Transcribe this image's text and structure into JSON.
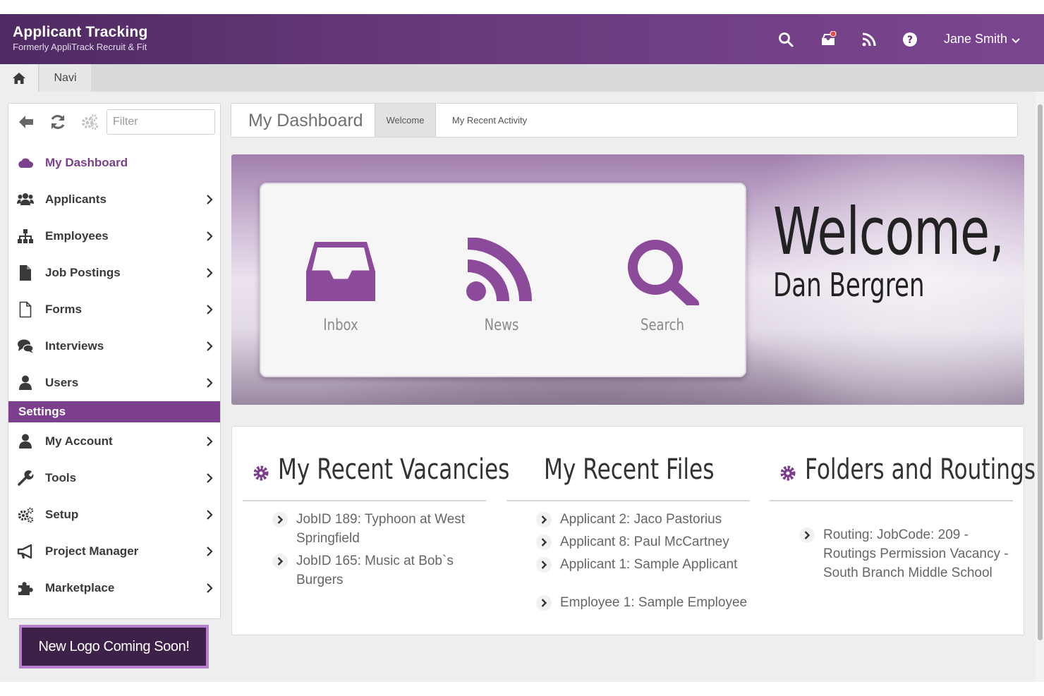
{
  "colors": {
    "brand_purple": "#6a3a7c",
    "accent": "#7b3f8e",
    "logo_button_bg": "#3e2149"
  },
  "header": {
    "app_title": "Applicant Tracking",
    "app_subtitle": "Formerly AppliTrack Recruit & Fit",
    "icons": [
      "search-icon",
      "notifications-icon",
      "rss-feed-icon",
      "help-icon"
    ],
    "user_name": "Jane Smith"
  },
  "breadcrumb": {
    "home_icon": "home-icon",
    "tab_label": "Navi"
  },
  "sidebar": {
    "filter_placeholder": "Filter",
    "tool_icons": [
      "back-icon",
      "refresh-icon",
      "settings-cogs-icon"
    ],
    "items": [
      {
        "label": "My Dashboard",
        "icon": "cloud-icon",
        "active": true
      },
      {
        "label": "Applicants",
        "icon": "users-icon"
      },
      {
        "label": "Employees",
        "icon": "org-chart-icon"
      },
      {
        "label": "Job Postings",
        "icon": "document-icon"
      },
      {
        "label": "Forms",
        "icon": "blank-file-icon"
      },
      {
        "label": "Interviews",
        "icon": "chat-icon"
      },
      {
        "label": "Users",
        "icon": "user-icon"
      }
    ],
    "settings_label": "Settings",
    "settings_items": [
      {
        "label": "My Account",
        "icon": "user-icon"
      },
      {
        "label": "Tools",
        "icon": "wrench-icon"
      },
      {
        "label": "Setup",
        "icon": "cogs-icon"
      },
      {
        "label": "Project Manager",
        "icon": "megaphone-icon"
      },
      {
        "label": "Marketplace",
        "icon": "puzzle-icon"
      }
    ],
    "logo_button": "New Logo Coming Soon!"
  },
  "dashboard": {
    "title": "My Dashboard",
    "tabs": [
      {
        "label": "Welcome",
        "active": true
      },
      {
        "label": "My Recent Activity",
        "active": false
      }
    ]
  },
  "welcome": {
    "quick_links": [
      {
        "label": "Inbox",
        "icon": "inbox-icon"
      },
      {
        "label": "News",
        "icon": "rss-feed-icon"
      },
      {
        "label": "Search",
        "icon": "search-icon"
      }
    ],
    "greeting": "Welcome,",
    "name": "Dan Bergren"
  },
  "panels": {
    "vacancies": {
      "title": "My Recent Vacancies",
      "items": [
        "JobID 189: Typhoon at West Springfield",
        "JobID 165: Music at Bob`s Burgers"
      ]
    },
    "files": {
      "title": "My Recent Files",
      "items": [
        "Applicant 2: Jaco Pastorius",
        "Applicant 8: Paul McCartney",
        "Applicant 1: Sample Applicant",
        "Employee 1: Sample Employee"
      ]
    },
    "folders": {
      "title": "Folders and Routings",
      "items": [
        "Routing: JobCode: 209 - Routings Permission Vacancy - South Branch Middle School"
      ]
    }
  }
}
